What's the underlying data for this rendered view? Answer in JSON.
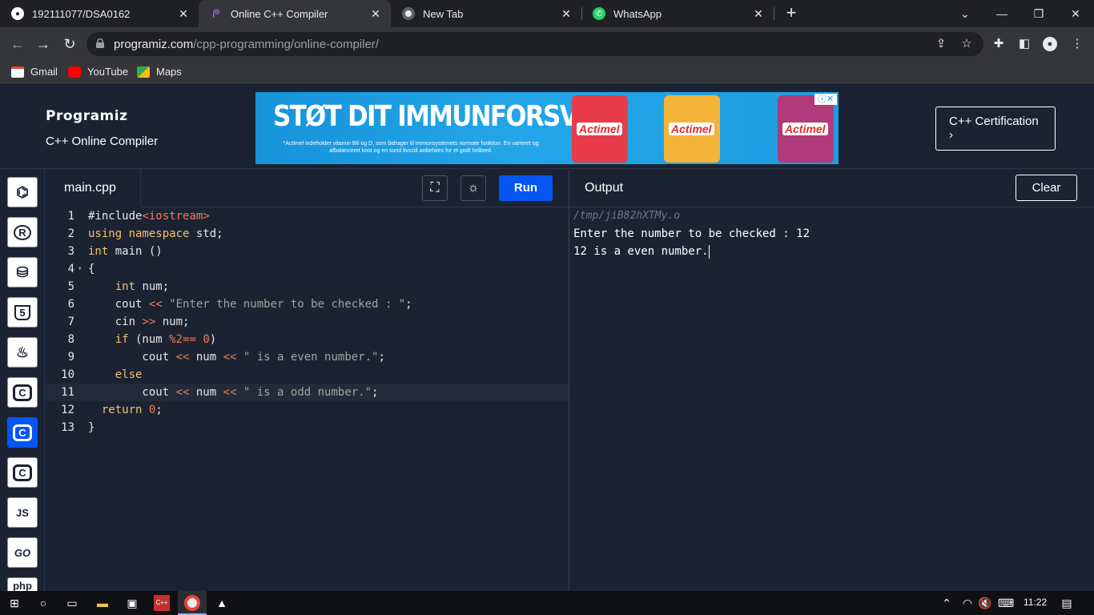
{
  "browser": {
    "tabs": [
      {
        "title": "192111077/DSA0162",
        "icon": "github-icon",
        "active": false
      },
      {
        "title": "Online C++ Compiler",
        "icon": "programiz-icon",
        "active": true
      },
      {
        "title": "New Tab",
        "icon": "chrome-icon",
        "active": false
      },
      {
        "title": "WhatsApp",
        "icon": "whatsapp-icon",
        "active": false
      }
    ],
    "url_host": "programiz.com",
    "url_path": "/cpp-programming/online-compiler/",
    "bookmarks": [
      {
        "label": "Gmail",
        "icon": "gmail-icon"
      },
      {
        "label": "YouTube",
        "icon": "youtube-icon"
      },
      {
        "label": "Maps",
        "icon": "maps-icon"
      }
    ]
  },
  "site": {
    "logo": "Programiz",
    "subtitle": "C++ Online Compiler",
    "certification_label": "C++ Certification",
    "certification_arrow": "›"
  },
  "ad": {
    "headline": "STØT DIT IMMUNFORSVAR",
    "fineprint": "*Actimel indeholder vitamin B6 og D, som bidrager til immunsystemets normale funktion. En varieret og afbalanceret kost og en sund livsstil anbefales for et godt helbred.",
    "brand": "Actimel",
    "colors": [
      "#e83b4a",
      "#f4b43a",
      "#b13a7a"
    ]
  },
  "languages": [
    {
      "name": "python",
      "label": "",
      "icon": "python-icon",
      "active": false
    },
    {
      "name": "r",
      "label": "R",
      "icon": "r-icon",
      "active": false
    },
    {
      "name": "sql",
      "label": "",
      "icon": "database-icon",
      "active": false
    },
    {
      "name": "html",
      "label": "5",
      "icon": "html5-icon",
      "active": false
    },
    {
      "name": "java",
      "label": "",
      "icon": "java-icon",
      "active": false
    },
    {
      "name": "c",
      "label": "C",
      "icon": "c-icon",
      "active": false
    },
    {
      "name": "cpp",
      "label": "C",
      "icon": "cpp-icon",
      "active": true
    },
    {
      "name": "csharp",
      "label": "C",
      "icon": "csharp-icon",
      "active": false
    },
    {
      "name": "js",
      "label": "JS",
      "icon": "javascript-icon",
      "active": false
    },
    {
      "name": "go",
      "label": "GO",
      "icon": "go-icon",
      "active": false
    },
    {
      "name": "php",
      "label": "php",
      "icon": "php-icon",
      "active": false
    }
  ],
  "editor": {
    "filename": "main.cpp",
    "run_label": "Run",
    "fullscreen_icon": "fullscreen-icon",
    "theme_icon": "sun-icon",
    "highlight_line": 11,
    "lines": [
      {
        "n": "1",
        "fold": "",
        "tokens": [
          {
            "t": "#include",
            "c": "plain"
          },
          {
            "t": "<iostream>",
            "c": "inc"
          }
        ]
      },
      {
        "n": "2",
        "fold": "",
        "tokens": [
          {
            "t": "using namespace",
            "c": "kw"
          },
          {
            "t": " std;",
            "c": "plain"
          }
        ]
      },
      {
        "n": "3",
        "fold": "",
        "tokens": [
          {
            "t": "int",
            "c": "kw"
          },
          {
            "t": " main ()",
            "c": "plain"
          }
        ]
      },
      {
        "n": "4",
        "fold": "▾",
        "tokens": [
          {
            "t": "{",
            "c": "plain"
          }
        ]
      },
      {
        "n": "5",
        "fold": "",
        "tokens": [
          {
            "t": "    ",
            "c": "plain"
          },
          {
            "t": "int",
            "c": "kw"
          },
          {
            "t": " num;",
            "c": "plain"
          }
        ]
      },
      {
        "n": "6",
        "fold": "",
        "tokens": [
          {
            "t": "    cout ",
            "c": "plain"
          },
          {
            "t": "<<",
            "c": "op"
          },
          {
            "t": " ",
            "c": "plain"
          },
          {
            "t": "\"Enter the number to be checked : \"",
            "c": "str"
          },
          {
            "t": ";",
            "c": "plain"
          }
        ]
      },
      {
        "n": "7",
        "fold": "",
        "tokens": [
          {
            "t": "    cin ",
            "c": "plain"
          },
          {
            "t": ">>",
            "c": "op"
          },
          {
            "t": " num;",
            "c": "plain"
          }
        ]
      },
      {
        "n": "8",
        "fold": "",
        "tokens": [
          {
            "t": "    ",
            "c": "plain"
          },
          {
            "t": "if",
            "c": "kw"
          },
          {
            "t": " (num ",
            "c": "plain"
          },
          {
            "t": "%2==",
            "c": "op"
          },
          {
            "t": " ",
            "c": "plain"
          },
          {
            "t": "0",
            "c": "num"
          },
          {
            "t": ")",
            "c": "plain"
          }
        ]
      },
      {
        "n": "9",
        "fold": "",
        "tokens": [
          {
            "t": "        cout ",
            "c": "plain"
          },
          {
            "t": "<<",
            "c": "op"
          },
          {
            "t": " num ",
            "c": "plain"
          },
          {
            "t": "<<",
            "c": "op"
          },
          {
            "t": " ",
            "c": "plain"
          },
          {
            "t": "\" is a even number.\"",
            "c": "str"
          },
          {
            "t": ";",
            "c": "plain"
          }
        ]
      },
      {
        "n": "10",
        "fold": "",
        "tokens": [
          {
            "t": "    ",
            "c": "plain"
          },
          {
            "t": "else",
            "c": "kw"
          }
        ]
      },
      {
        "n": "11",
        "fold": "",
        "tokens": [
          {
            "t": "        cout ",
            "c": "plain"
          },
          {
            "t": "<<",
            "c": "op"
          },
          {
            "t": " num ",
            "c": "plain"
          },
          {
            "t": "<<",
            "c": "op"
          },
          {
            "t": " ",
            "c": "plain"
          },
          {
            "t": "\" is a odd number.\"",
            "c": "str"
          },
          {
            "t": ";",
            "c": "plain"
          }
        ]
      },
      {
        "n": "12",
        "fold": "",
        "tokens": [
          {
            "t": "  ",
            "c": "plain"
          },
          {
            "t": "return",
            "c": "kw"
          },
          {
            "t": " ",
            "c": "plain"
          },
          {
            "t": "0",
            "c": "num"
          },
          {
            "t": ";",
            "c": "plain"
          }
        ]
      },
      {
        "n": "13",
        "fold": "",
        "tokens": [
          {
            "t": "}",
            "c": "plain"
          }
        ]
      }
    ]
  },
  "output": {
    "title": "Output",
    "clear_label": "Clear",
    "path": "/tmp/jiB82hXTMy.o",
    "lines": [
      "Enter the number to be checked : 12",
      "12 is a even number."
    ]
  },
  "taskbar": {
    "time": "11:22",
    "apps": [
      "start-icon",
      "search-icon",
      "task-view-icon",
      "file-explorer-icon",
      "terminal-icon",
      "devcpp-icon",
      "chrome-icon",
      "photos-icon"
    ]
  }
}
